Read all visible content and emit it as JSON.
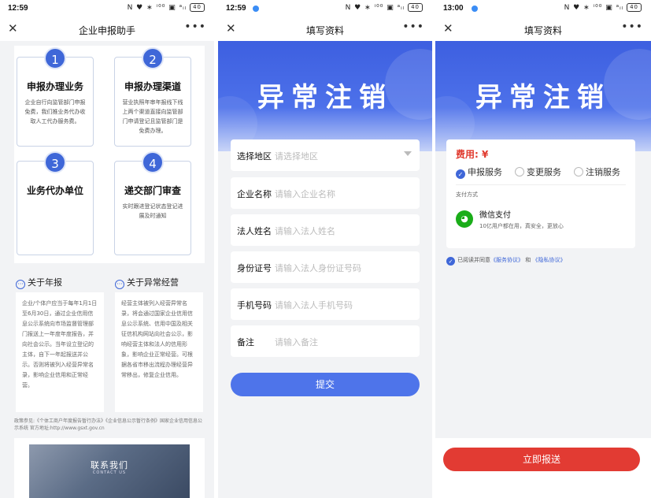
{
  "statusbar": {
    "screen1_time": "12:59",
    "screen2_time": "12:59",
    "screen3_time": "13:00",
    "icons": "N ♥ ∗ ⁱ⁰⁰ ▣ ᵃᵢₗ",
    "battery": "40"
  },
  "screen1": {
    "title": "企业申报助手",
    "steps": [
      {
        "num": "1",
        "title": "申报办理业务",
        "desc": "企业自行向监管部门申报免费，我们推业务代办收取人工代办服务费。"
      },
      {
        "num": "2",
        "title": "申报办理渠道",
        "desc": "营业执照年审年报线下线上两个渠道直接向监管部门申请登记且监管部门是免费办理。"
      },
      {
        "num": "3",
        "title": "业务代办单位",
        "desc": ""
      },
      {
        "num": "4",
        "title": "递交部门审查",
        "desc": "实时跟进登记状态登记进展及时通知"
      }
    ],
    "about_annual": {
      "title": "关于年报",
      "text": "企业/个体户应当于每年1月1日至6月30日，通过企业信用信息公示系统向市场监督管理部门报送上一年度年度报告，并向社会公示。当年设立登记的主体，自下一年起报送并公示。否则将被列入经营异常名录，影响企业信用和正常经营。"
    },
    "about_abnormal": {
      "title": "关于异常经营",
      "text": "经营主体被列入经营异常名录，将会通过国家企业信用信息公示系统、信用中国及相关征信机构网站向社会公示，影响经营主体和法人的信用形象，影响企业正常经营。可根据各省市移出流程办理经营异常移出，修复企业信用。"
    },
    "policy": "政策参见:《个体工商户年度报告暂行办法》《企业信息公示暂行条例》国家企业信用信息公示系统 官方地址:http://www.gsxt.gov.cn",
    "contact": {
      "title": "联系我们",
      "subtitle": "CONTACT US"
    }
  },
  "screen2": {
    "title": "填写资料",
    "banner": "异常注销",
    "fields": [
      {
        "label": "选择地区",
        "placeholder": "请选择地区",
        "dropdown": true
      },
      {
        "label": "企业名称",
        "placeholder": "请输入企业名称",
        "dropdown": false
      },
      {
        "label": "法人姓名",
        "placeholder": "请输入法人姓名",
        "dropdown": false
      },
      {
        "label": "身份证号",
        "placeholder": "请输入法人身份证号码",
        "dropdown": false
      },
      {
        "label": "手机号码",
        "placeholder": "请输入法人手机号码",
        "dropdown": false
      },
      {
        "label": "备注",
        "placeholder": "请输入备注",
        "dropdown": false
      }
    ],
    "submit": "提交"
  },
  "screen3": {
    "title": "填写资料",
    "banner": "异常注销",
    "fee_label": "费用: ¥",
    "services": [
      {
        "label": "申报服务",
        "selected": true
      },
      {
        "label": "变更服务",
        "selected": false
      },
      {
        "label": "注销服务",
        "selected": false
      }
    ],
    "pay_method_label": "支付方式",
    "wechat_name": "微信支付",
    "wechat_desc": "10亿用户都在用，真安全，更放心",
    "agree_prefix": "已阅读并同意",
    "agree_link1": "《服务协议》",
    "agree_and": "和",
    "agree_link2": "《隐私协议》",
    "report_button": "立即报送"
  },
  "colors": {
    "primary_blue": "#3f67d8",
    "submit_blue": "#4e74ea",
    "report_red": "#e23b33",
    "fee_red": "#e03a2e",
    "wechat_green": "#1aad19"
  }
}
